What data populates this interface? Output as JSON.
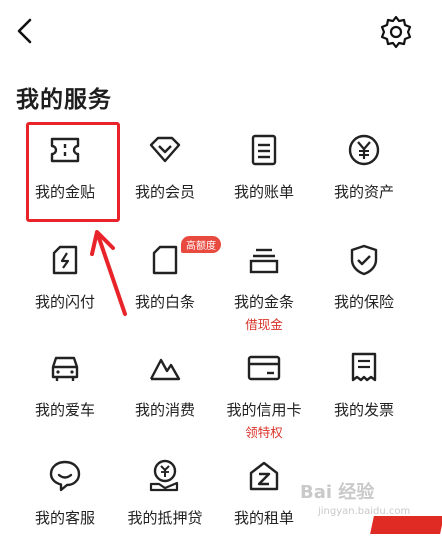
{
  "header": {
    "back_icon": "chevron-left-icon",
    "settings_icon": "gear-icon"
  },
  "section": {
    "title": "我的服务"
  },
  "services": [
    {
      "id": "jintie",
      "label": "我的金贴",
      "icon": "ticket-icon"
    },
    {
      "id": "member",
      "label": "我的会员",
      "icon": "diamond-icon"
    },
    {
      "id": "bill",
      "label": "我的账单",
      "icon": "bill-icon"
    },
    {
      "id": "assets",
      "label": "我的资产",
      "icon": "yen-circle-icon"
    },
    {
      "id": "shanfu",
      "label": "我的闪付",
      "icon": "flash-card-icon"
    },
    {
      "id": "baitiao",
      "label": "我的白条",
      "icon": "baitiao-card-icon",
      "badge": "高额度"
    },
    {
      "id": "jintiao",
      "label": "我的金条",
      "icon": "stack-icon",
      "sub": "借现金"
    },
    {
      "id": "insurance",
      "label": "我的保险",
      "icon": "shield-check-icon"
    },
    {
      "id": "car",
      "label": "我的爱车",
      "icon": "car-icon"
    },
    {
      "id": "consume",
      "label": "我的消费",
      "icon": "mountain-icon"
    },
    {
      "id": "creditcard",
      "label": "我的信用卡",
      "icon": "credit-card-icon",
      "sub": "领特权"
    },
    {
      "id": "invoice",
      "label": "我的发票",
      "icon": "receipt-icon"
    },
    {
      "id": "service",
      "label": "我的客服",
      "icon": "chat-bubble-icon"
    },
    {
      "id": "mortgage",
      "label": "我的抵押贷",
      "icon": "yen-hand-icon"
    },
    {
      "id": "rent",
      "label": "我的租单",
      "icon": "house-z-icon"
    }
  ],
  "watermark": {
    "brand": "Bai 经验",
    "url": "jingyan.baidu.com"
  },
  "colors": {
    "highlight": "#e8242a",
    "accent": "#d9342a",
    "badge": "#e84a3f"
  }
}
